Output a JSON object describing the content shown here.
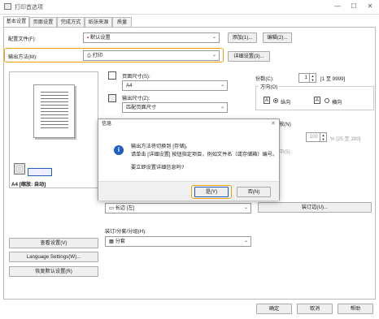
{
  "window": {
    "title": "打印首选项",
    "minimize": "—",
    "maximize": "☐",
    "close": "✕"
  },
  "tabs": [
    "基本设置",
    "页面设置",
    "完成方式",
    "纸张来源",
    "质量"
  ],
  "profile": {
    "label": "配置文件(F):",
    "value": "默认设置",
    "add": "添加(1)...",
    "edit": "编辑(2)..."
  },
  "output": {
    "label": "输出方法(M):",
    "value": "打印",
    "detail": "详细设置(3)..."
  },
  "preview": {
    "caption": "A4 [缩放: 自动]",
    "btn_view": "查看设置(V)",
    "btn_lang": "Language Settings(W)...",
    "btn_restore": "恢复默认设置(R)"
  },
  "page_size": {
    "label": "页面尺寸(S):",
    "value": "A4"
  },
  "output_size": {
    "label": "输出尺寸(Z):",
    "value": "匹配页面尺寸"
  },
  "copies": {
    "label": "份数(C):",
    "value": "1",
    "range": "[1 至 9999]"
  },
  "orientation": {
    "label": "方向(O)",
    "portrait": "纵向",
    "landscape": "横向",
    "selected": "portrait"
  },
  "scaling": {
    "label_partial": "放(N)",
    "value": "100",
    "range": "% [25 至 200]",
    "sub": "中(5)"
  },
  "binding": {
    "value": "长边 [左]",
    "margin_btn": "装订边(U)..."
  },
  "staple": {
    "label": "装订/分套/分组(H):",
    "value": "分套"
  },
  "footer": {
    "ok": "确定",
    "cancel": "取消",
    "help": "帮助"
  },
  "dialog": {
    "title": "信息",
    "line1": "输出方法将切换到 [存储]。",
    "line2": "请单击 [详细设置] 按钮指定项目，例如文件名（或存储箱）编号。",
    "line3": "要立即设置详细信息吗?",
    "yes": "是(Y)",
    "no": "否(N)"
  },
  "colors": {
    "highlight": "#f0a500",
    "info": "#1f5fbf"
  }
}
